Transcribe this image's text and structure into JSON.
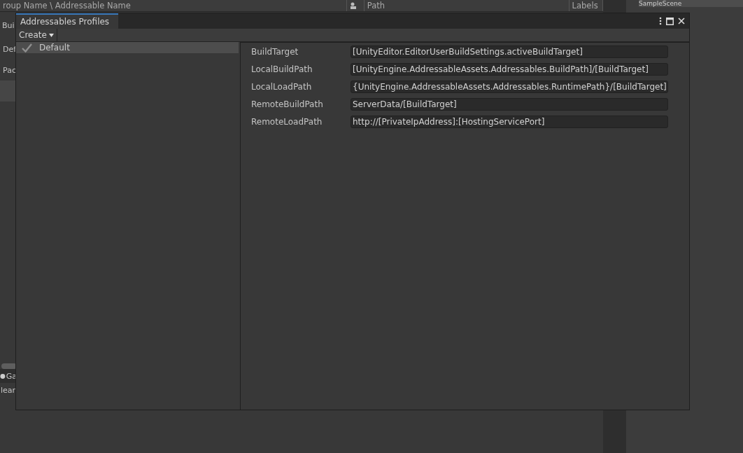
{
  "background": {
    "columns": [
      "roup Name \\ Addressable Name",
      "Path",
      "Labels"
    ],
    "hierarchy_item": "SampleScene",
    "side_fragments": [
      {
        "text": "Bui",
        "kind": "header"
      },
      {
        "text": "Def",
        "kind": "foldout"
      },
      {
        "text": "Pac",
        "kind": "foldout"
      },
      {
        "kind": "band"
      },
      {
        "text": "Ga",
        "kind": "icon"
      },
      {
        "text": "lear",
        "kind": "plain"
      }
    ]
  },
  "window": {
    "title": "Addressables Profiles",
    "create_button": "Create",
    "profiles": [
      {
        "name": "Default",
        "selected": true,
        "checked": true
      }
    ],
    "variables": [
      {
        "name": "BuildTarget",
        "value": "[UnityEditor.EditorUserBuildSettings.activeBuildTarget]"
      },
      {
        "name": "LocalBuildPath",
        "value": "[UnityEngine.AddressableAssets.Addressables.BuildPath]/[BuildTarget]"
      },
      {
        "name": "LocalLoadPath",
        "value": "{UnityEngine.AddressableAssets.Addressables.RuntimePath}/[BuildTarget]"
      },
      {
        "name": "RemoteBuildPath",
        "value": "ServerData/[BuildTarget]"
      },
      {
        "name": "RemoteLoadPath",
        "value": "http://[PrivateIpAddress]:[HostingServicePort]"
      }
    ]
  }
}
